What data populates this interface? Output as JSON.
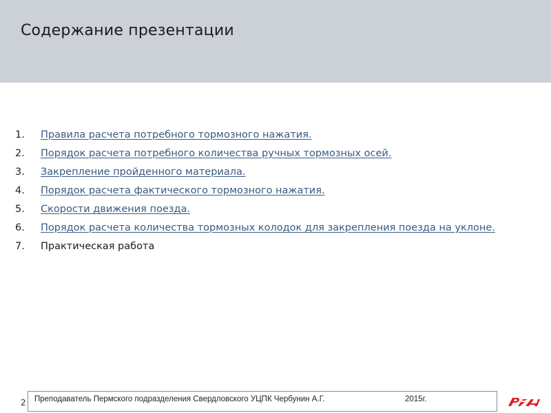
{
  "slide": {
    "title": "Содержание презентации",
    "page_number": "2"
  },
  "toc": [
    {
      "num": "1.",
      "text": "Правила расчета потребного тормозного нажатия.",
      "link": true
    },
    {
      "num": "2.",
      "text": "Порядок расчета потребного количества ручных тормозных осей.",
      "link": true
    },
    {
      "num": "3.",
      "text": "Закрепление пройденного материала.",
      "link": true
    },
    {
      "num": "4.",
      "text": "Порядок расчета фактического тормозного нажатия.",
      "link": true
    },
    {
      "num": "5.",
      "text": "Скорости движения поезда.",
      "link": true
    },
    {
      "num": "6.",
      "text": "Порядок расчета количества тормозных колодок для закрепления поезда на уклоне.",
      "link": true
    },
    {
      "num": "7.",
      "text": "Практическая работа",
      "link": false
    }
  ],
  "footer": {
    "author": "Преподаватель Пермского подразделения Свердловского УЦПК Чербунин А.Г.",
    "year": "2015г."
  },
  "logo": {
    "icon": "rzd-logo-icon",
    "color": "#e21a1a"
  },
  "colors": {
    "header_bg": "#ccd1d8",
    "link": "#375a82"
  }
}
